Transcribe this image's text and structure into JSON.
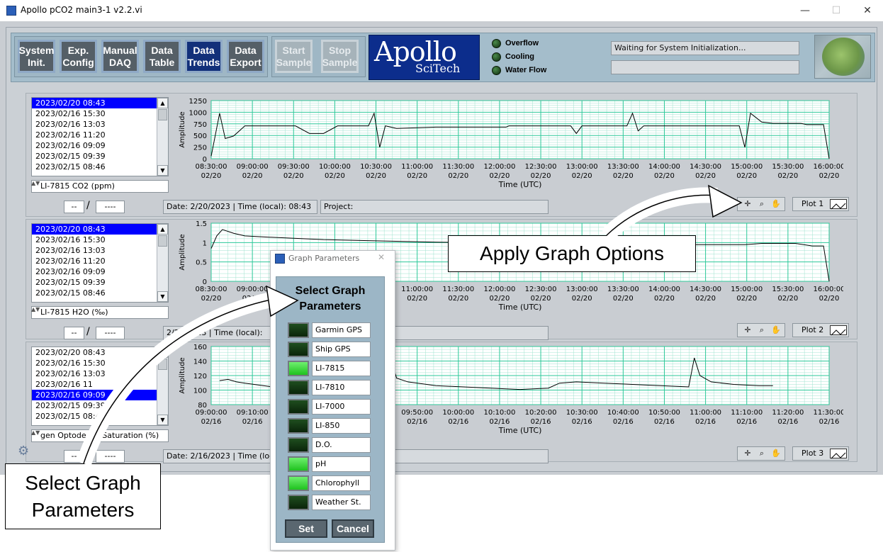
{
  "window": {
    "title": "Apollo pCO2 main3-1 v2.2.vi",
    "controls": {
      "minimize": "—",
      "maximize": "☐",
      "close": "✕"
    }
  },
  "nav": [
    {
      "label": "System\nInit.",
      "state": "normal"
    },
    {
      "label": "Exp.\nConfig",
      "state": "normal"
    },
    {
      "label": "Manual\nDAQ",
      "state": "normal"
    },
    {
      "label": "Data\nTable",
      "state": "normal"
    },
    {
      "label": "Data\nTrends",
      "state": "active"
    },
    {
      "label": "Data\nExport",
      "state": "normal"
    },
    {
      "label": "Start\nSample",
      "state": "disabled"
    },
    {
      "label": "Stop\nSample",
      "state": "disabled"
    }
  ],
  "logo": {
    "main": "Apollo",
    "sub": "SciTech"
  },
  "indicators": [
    {
      "label": "Overflow"
    },
    {
      "label": "Cooling"
    },
    {
      "label": "Water Flow"
    }
  ],
  "status": {
    "message": "Waiting for System Initialization...",
    "secondary": ""
  },
  "plots": [
    {
      "list_items": [
        "2023/02/20  08:43",
        "2023/02/16  15:30",
        "2023/02/16  13:03",
        "2023/02/16  11:20",
        "2023/02/16  09:09",
        "2023/02/15  09:39",
        "2023/02/15  08:46"
      ],
      "selected_index": 0,
      "parameter": "LI-7815 CO2 (ppm)",
      "field_a": "--",
      "field_b": "----",
      "date_info": "Date: 2/20/2023 | Time (local): 08:43",
      "project": "Project:",
      "plot_label": "Plot 1",
      "graph": {
        "ylabel": "Amplitude",
        "xlabel": "Time (UTC)",
        "yticks": [
          "1250",
          "1000",
          "750",
          "500",
          "250",
          "0"
        ],
        "xticks": [
          [
            "08:30:00",
            "02/20"
          ],
          [
            "09:00:00",
            "02/20"
          ],
          [
            "09:30:00",
            "02/20"
          ],
          [
            "10:00:00",
            "02/20"
          ],
          [
            "10:30:00",
            "02/20"
          ],
          [
            "11:00:00",
            "02/20"
          ],
          [
            "11:30:00",
            "02/20"
          ],
          [
            "12:00:00",
            "02/20"
          ],
          [
            "12:30:00",
            "02/20"
          ],
          [
            "13:00:00",
            "02/20"
          ],
          [
            "13:30:00",
            "02/20"
          ],
          [
            "14:00:00",
            "02/20"
          ],
          [
            "14:30:00",
            "02/20"
          ],
          [
            "15:00:00",
            "02/20"
          ],
          [
            "15:30:00",
            "02/20"
          ],
          [
            "16:00:00",
            "02/20"
          ]
        ]
      }
    },
    {
      "list_items": [
        "2023/02/20  08:43",
        "2023/02/16  15:30",
        "2023/02/16  13:03",
        "2023/02/16  11:20",
        "2023/02/16  09:09",
        "2023/02/15  09:39",
        "2023/02/15  08:46"
      ],
      "selected_index": 0,
      "parameter": "LI-7815 H2O (‰)",
      "field_a": "--",
      "field_b": "----",
      "date_info": "2/20/2023 | Time (local):",
      "project": "",
      "plot_label": "Plot 2",
      "graph": {
        "ylabel": "Amplitude",
        "xlabel": "Time (UTC)",
        "yticks": [
          "1.5",
          "1",
          "0.5",
          "0"
        ],
        "xticks": [
          [
            "08:30:00",
            "02/20"
          ],
          [
            "09:00:00",
            "02/20"
          ],
          [
            "",
            ""
          ],
          [
            "",
            ""
          ],
          [
            "",
            ""
          ],
          [
            "11:00:00",
            "02/20"
          ],
          [
            "11:30:00",
            "02/20"
          ],
          [
            "12:00:00",
            "02/20"
          ],
          [
            "12:30:00",
            "02/20"
          ],
          [
            "13:00:00",
            "02/20"
          ],
          [
            "13:30:00",
            "02/20"
          ],
          [
            "14:00:00",
            "02/20"
          ],
          [
            "14:30:00",
            "02/20"
          ],
          [
            "15:00:00",
            "02/20"
          ],
          [
            "15:30:00",
            "02/20"
          ],
          [
            "16:00:00",
            "02/20"
          ]
        ]
      }
    },
    {
      "list_items": [
        "2023/02/20  08:43",
        "2023/02/16  15:30",
        "2023/02/16  13:03",
        "2023/02/16  11",
        "2023/02/16  09:09",
        "2023/02/15  09:39",
        "2023/02/15  08:46"
      ],
      "selected_index": 4,
      "parameter": "gen Optode O2 Saturation (%)",
      "field_a": "--",
      "field_b": "----",
      "date_info": "Date: 2/16/2023 | Time (local):",
      "project": "",
      "plot_label": "Plot 3",
      "graph": {
        "ylabel": "Amplitude",
        "xlabel": "Time (UTC)",
        "yticks": [
          "160",
          "140",
          "120",
          "100",
          "80"
        ],
        "xticks": [
          [
            "09:00:00",
            "02/16"
          ],
          [
            "09:10:00",
            "02/16"
          ],
          [
            "",
            ""
          ],
          [
            "",
            ""
          ],
          [
            "",
            ""
          ],
          [
            "09:50:00",
            "02/16"
          ],
          [
            "10:00:00",
            "02/16"
          ],
          [
            "10:10:00",
            "02/16"
          ],
          [
            "10:20:00",
            "02/16"
          ],
          [
            "10:30:00",
            "02/16"
          ],
          [
            "10:40:00",
            "02/16"
          ],
          [
            "10:50:00",
            "02/16"
          ],
          [
            "11:00:00",
            "02/16"
          ],
          [
            "11:10:00",
            "02/16"
          ],
          [
            "11:20:00",
            "02/16"
          ],
          [
            "11:30:00",
            "02/16"
          ]
        ]
      }
    }
  ],
  "dialog": {
    "title": "Graph Parameters",
    "heading": "Select Graph Parameters",
    "options": [
      {
        "label": "Garmin GPS",
        "on": false
      },
      {
        "label": "Ship GPS",
        "on": false
      },
      {
        "label": "LI-7815",
        "on": true
      },
      {
        "label": "LI-7810",
        "on": false
      },
      {
        "label": "LI-7000",
        "on": false
      },
      {
        "label": "LI-850",
        "on": false
      },
      {
        "label": "D.O.",
        "on": false
      },
      {
        "label": "pH",
        "on": true
      },
      {
        "label": "Chlorophyll",
        "on": true
      },
      {
        "label": "Weather St.",
        "on": false
      }
    ],
    "set_label": "Set",
    "cancel_label": "Cancel"
  },
  "callouts": {
    "apply": "Apply Graph Options",
    "select": "Select Graph\nParameters"
  }
}
